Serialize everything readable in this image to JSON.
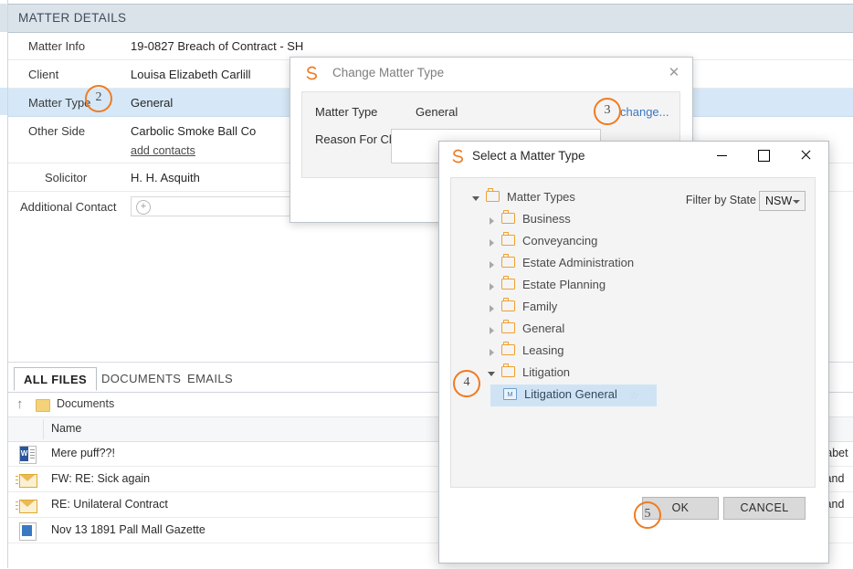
{
  "matter_details": {
    "header": "MATTER DETAILS",
    "rows": [
      {
        "label": "Matter Info",
        "value": "19-0827 Breach of Contract - SH"
      },
      {
        "label": "Client",
        "value": "Louisa Elizabeth Carlill"
      },
      {
        "label": "Matter Type",
        "value": "General"
      },
      {
        "label": "Other Side",
        "value": "Carbolic Smoke Ball Co",
        "sublink": "add contacts"
      },
      {
        "label": "Solicitor",
        "value": "H. H. Asquith"
      },
      {
        "label": "Additional Contact",
        "value": ""
      }
    ],
    "add_icon": "plus-circle-icon"
  },
  "badges": [
    {
      "num": "2"
    },
    {
      "num": "3"
    },
    {
      "num": "4"
    },
    {
      "num": "5"
    }
  ],
  "change_matter_type_dialog": {
    "title": "Change Matter Type",
    "logo": "smokeball-swirl-icon",
    "close": "close-icon",
    "matter_type_label": "Matter Type",
    "matter_type_value": "General",
    "change_link": "change...",
    "reason_label": "Reason For Change",
    "reason_value": ""
  },
  "select_matter_type_dialog": {
    "title": "Select a Matter Type",
    "logo": "smokeball-swirl-icon",
    "minimize": "minimize-icon",
    "maximize": "maximize-icon",
    "close": "close-icon",
    "filter_label": "Filter by State",
    "filter_value": "NSW",
    "tree": [
      {
        "label": "Matter Types",
        "level": 0,
        "state": "expanded",
        "type": "folder"
      },
      {
        "label": "Business",
        "level": 1,
        "state": "collapsed",
        "type": "folder"
      },
      {
        "label": "Conveyancing",
        "level": 1,
        "state": "collapsed",
        "type": "folder"
      },
      {
        "label": "Estate Administration",
        "level": 1,
        "state": "collapsed",
        "type": "folder"
      },
      {
        "label": "Estate Planning",
        "level": 1,
        "state": "collapsed",
        "type": "folder"
      },
      {
        "label": "Family",
        "level": 1,
        "state": "collapsed",
        "type": "folder"
      },
      {
        "label": "General",
        "level": 1,
        "state": "collapsed",
        "type": "folder"
      },
      {
        "label": "Leasing",
        "level": 1,
        "state": "collapsed",
        "type": "folder"
      },
      {
        "label": "Litigation",
        "level": 1,
        "state": "expanded",
        "type": "folder"
      },
      {
        "label": "Litigation General",
        "level": 2,
        "state": "leaf",
        "type": "matter-type",
        "selected": true,
        "star": "☆"
      }
    ],
    "ok": "OK",
    "cancel": "CANCEL"
  },
  "files_panel": {
    "tabs": [
      {
        "label": "ALL FILES",
        "active": true
      },
      {
        "label": "DOCUMENTS",
        "active": false
      },
      {
        "label": "EMAILS",
        "active": false
      }
    ],
    "breadcrumb": {
      "up_icon": "arrow-up-icon",
      "folder_icon": "folder-icon",
      "label": "Documents"
    },
    "column_header": "Name",
    "rows": [
      {
        "icon": "word-document-icon",
        "name": "Mere puff??!",
        "right": "zabet"
      },
      {
        "icon": "email-icon",
        "name": "FW: RE: Sick again",
        "right": "lland"
      },
      {
        "icon": "email-icon",
        "name": "RE: Unilateral Contract",
        "right": "lland"
      },
      {
        "icon": "image-document-icon",
        "name": "Nov 13 1891 Pall Mall Gazette",
        "right": ""
      }
    ]
  },
  "colors": {
    "accent_orange": "#f07b22",
    "header_bg": "#dbe3ea",
    "row_selected": "#d6e8f7",
    "link_blue": "#3b77c4",
    "folder_orange": "#f0a030"
  }
}
